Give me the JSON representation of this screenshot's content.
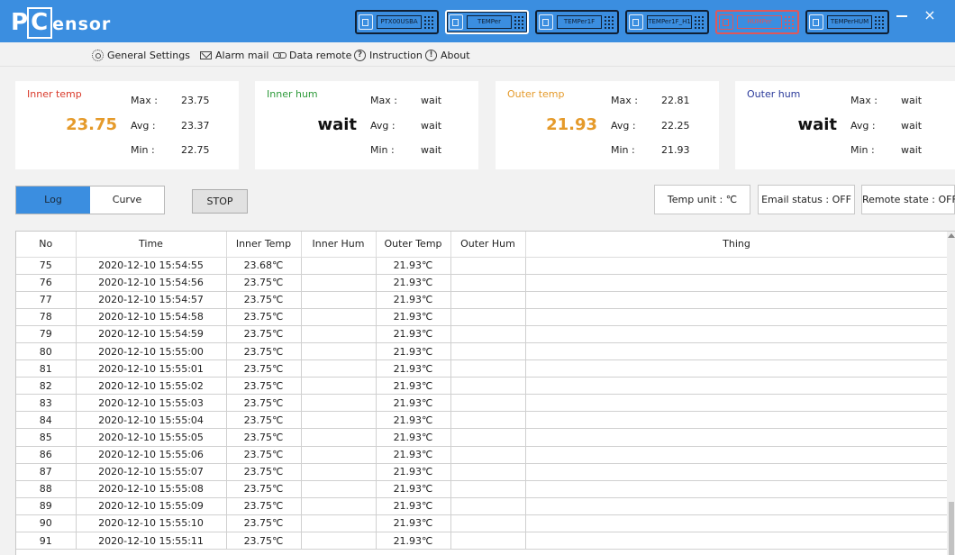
{
  "app": {
    "logo_pc": "P",
    "logo_c": "C",
    "logo_rest": "ensor"
  },
  "devices": [
    {
      "label": "PTX00USBA",
      "state": "normal"
    },
    {
      "label": "TEMPer",
      "state": "selected"
    },
    {
      "label": "TEMPer1F",
      "state": "normal"
    },
    {
      "label": "TEMPer1F_H1",
      "state": "normal"
    },
    {
      "label": "HUMPer",
      "state": "error"
    },
    {
      "label": "TEMPerHUM",
      "state": "normal"
    }
  ],
  "window": {
    "minimize": "—",
    "close": "×"
  },
  "menu": {
    "general_settings": "General Settings",
    "alarm_mail": "Alarm mail",
    "data_remote": "Data remote",
    "instruction": "Instruction",
    "about": "About",
    "instruction_icon": "?",
    "about_icon": "!"
  },
  "cards": [
    {
      "name": "Inner temp",
      "value": "23.75",
      "max": "23.75",
      "avg": "23.37",
      "min": "22.75",
      "name_color": "#d93a2b",
      "value_color": "#e59a2a"
    },
    {
      "name": "Inner hum",
      "value": "wait",
      "max": "wait",
      "avg": "wait",
      "min": "wait",
      "name_color": "#2e9a3a",
      "value_color": "#111111"
    },
    {
      "name": "Outer temp",
      "value": "21.93",
      "max": "22.81",
      "avg": "22.25",
      "min": "21.93",
      "name_color": "#e59a2a",
      "value_color": "#e59a2a"
    },
    {
      "name": "Outer hum",
      "value": "wait",
      "max": "wait",
      "avg": "wait",
      "min": "wait",
      "name_color": "#2a3a9a",
      "value_color": "#111111"
    }
  ],
  "stat_labels": {
    "max": "Max :",
    "avg": "Avg :",
    "min": "Min :"
  },
  "controls": {
    "tab_log": "Log",
    "tab_curve": "Curve",
    "stop": "STOP",
    "temp_unit": "Temp unit : ℃",
    "email_status": "Email status : OFF",
    "remote_state": "Remote state : OFF"
  },
  "table": {
    "columns": [
      "No",
      "Time",
      "Inner Temp",
      "Inner Hum",
      "Outer Temp",
      "Outer Hum",
      "Thing"
    ],
    "rows": [
      [
        "75",
        "2020-12-10 15:54:55",
        "23.68℃",
        "",
        "21.93℃",
        "",
        ""
      ],
      [
        "76",
        "2020-12-10 15:54:56",
        "23.75℃",
        "",
        "21.93℃",
        "",
        ""
      ],
      [
        "77",
        "2020-12-10 15:54:57",
        "23.75℃",
        "",
        "21.93℃",
        "",
        ""
      ],
      [
        "78",
        "2020-12-10 15:54:58",
        "23.75℃",
        "",
        "21.93℃",
        "",
        ""
      ],
      [
        "79",
        "2020-12-10 15:54:59",
        "23.75℃",
        "",
        "21.93℃",
        "",
        ""
      ],
      [
        "80",
        "2020-12-10 15:55:00",
        "23.75℃",
        "",
        "21.93℃",
        "",
        ""
      ],
      [
        "81",
        "2020-12-10 15:55:01",
        "23.75℃",
        "",
        "21.93℃",
        "",
        ""
      ],
      [
        "82",
        "2020-12-10 15:55:02",
        "23.75℃",
        "",
        "21.93℃",
        "",
        ""
      ],
      [
        "83",
        "2020-12-10 15:55:03",
        "23.75℃",
        "",
        "21.93℃",
        "",
        ""
      ],
      [
        "84",
        "2020-12-10 15:55:04",
        "23.75℃",
        "",
        "21.93℃",
        "",
        ""
      ],
      [
        "85",
        "2020-12-10 15:55:05",
        "23.75℃",
        "",
        "21.93℃",
        "",
        ""
      ],
      [
        "86",
        "2020-12-10 15:55:06",
        "23.75℃",
        "",
        "21.93℃",
        "",
        ""
      ],
      [
        "87",
        "2020-12-10 15:55:07",
        "23.75℃",
        "",
        "21.93℃",
        "",
        ""
      ],
      [
        "88",
        "2020-12-10 15:55:08",
        "23.75℃",
        "",
        "21.93℃",
        "",
        ""
      ],
      [
        "89",
        "2020-12-10 15:55:09",
        "23.75℃",
        "",
        "21.93℃",
        "",
        ""
      ],
      [
        "90",
        "2020-12-10 15:55:10",
        "23.75℃",
        "",
        "21.93℃",
        "",
        ""
      ],
      [
        "91",
        "2020-12-10 15:55:11",
        "23.75℃",
        "",
        "21.93℃",
        "",
        ""
      ]
    ]
  }
}
